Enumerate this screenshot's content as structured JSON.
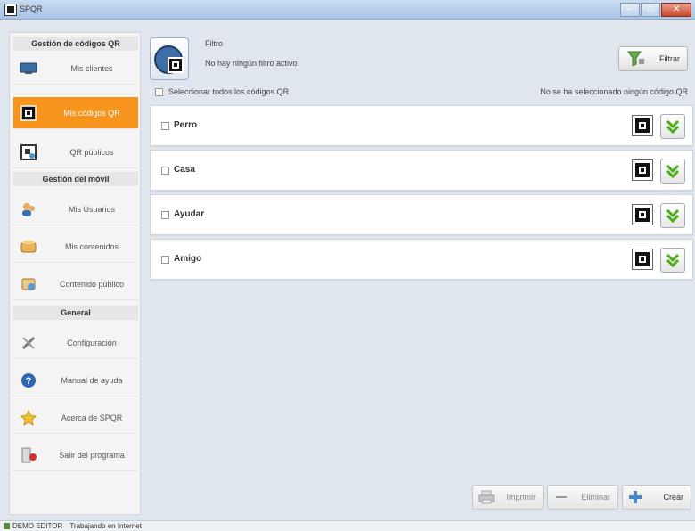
{
  "window": {
    "title": "SPQR"
  },
  "sidebar": {
    "sections": [
      {
        "header": "Gestión de códigos QR",
        "items": [
          {
            "label": "Mis clientes",
            "icon": "monitor-icon",
            "active": false
          },
          {
            "label": "Mis códigos QR",
            "icon": "qr-code-icon",
            "active": true
          },
          {
            "label": "QR públicos",
            "icon": "public-qr-icon",
            "active": false
          }
        ]
      },
      {
        "header": "Gestión del móvil",
        "items": [
          {
            "label": "Mis Usuarios",
            "icon": "users-icon",
            "active": false
          },
          {
            "label": "Mis contenidos",
            "icon": "contents-icon",
            "active": false
          },
          {
            "label": "Contenido público",
            "icon": "public-content-icon",
            "active": false
          }
        ]
      },
      {
        "header": "General",
        "items": [
          {
            "label": "Configuración",
            "icon": "tools-icon",
            "active": false
          },
          {
            "label": "Manual de ayuda",
            "icon": "help-icon",
            "active": false
          },
          {
            "label": "Acerca de SPQR",
            "icon": "star-icon",
            "active": false
          },
          {
            "label": "Salir del programa",
            "icon": "exit-icon",
            "active": false
          }
        ]
      }
    ]
  },
  "filter": {
    "title": "Filtro",
    "status": "No hay ningún filtro activo.",
    "button_label": "Filtrar"
  },
  "selection": {
    "select_all_label": "Seleccionar todos los códigos QR",
    "info": "No se ha seleccionado ningún código QR"
  },
  "qr_list": [
    {
      "name": "Perro"
    },
    {
      "name": "Casa"
    },
    {
      "name": "Ayudar"
    },
    {
      "name": "Amigo"
    }
  ],
  "actions": {
    "print_label": "Imprimir",
    "delete_label": "Eliminar",
    "create_label": "Crear"
  },
  "statusbar": {
    "user": "DEMO EDITOR",
    "status": "Trabajando en Internet"
  },
  "colors": {
    "accent": "#f7941d",
    "expand_green": "#4caf1a"
  }
}
